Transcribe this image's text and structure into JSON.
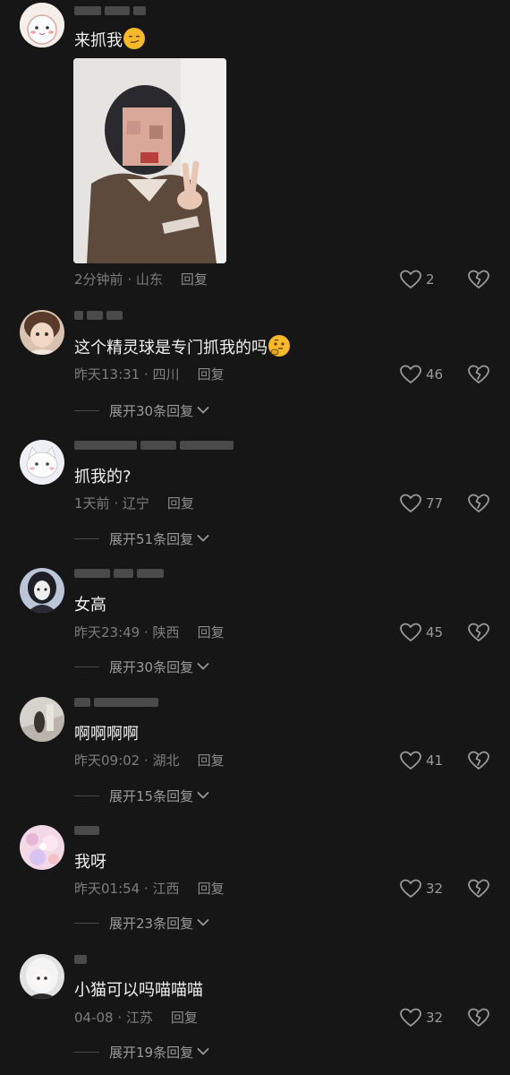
{
  "comments": [
    {
      "text": "来抓我",
      "emoji": "smirk-emoji",
      "time": "2分钟前",
      "location": "山东",
      "reply_label": "回复",
      "likes": "2"
    },
    {
      "text": "这个精灵球是专门抓我的吗",
      "emoji": "thinking-emoji",
      "time": "昨天13:31",
      "location": "四川",
      "reply_label": "回复",
      "likes": "46",
      "expand_label": "展开30条回复"
    },
    {
      "text": "抓我的?",
      "time": "1天前",
      "location": "辽宁",
      "reply_label": "回复",
      "likes": "77",
      "expand_label": "展开51条回复"
    },
    {
      "text": "女高",
      "time": "昨天23:49",
      "location": "陕西",
      "reply_label": "回复",
      "likes": "45",
      "expand_label": "展开30条回复"
    },
    {
      "text": "啊啊啊啊",
      "time": "昨天09:02",
      "location": "湖北",
      "reply_label": "回复",
      "likes": "41",
      "expand_label": "展开15条回复"
    },
    {
      "text": "我呀",
      "time": "昨天01:54",
      "location": "江西",
      "reply_label": "回复",
      "likes": "32",
      "expand_label": "展开23条回复"
    },
    {
      "text": "小猫可以吗喵喵喵",
      "time": "04-08",
      "location": "江苏",
      "reply_label": "回复",
      "likes": "32",
      "expand_label": "展开19条回复"
    }
  ],
  "colors": {
    "background": "#161616",
    "text": "#f0f0f0",
    "meta": "#7d7d7d"
  },
  "icons": {
    "like": "heart-outline-icon",
    "dislike": "broken-heart-icon",
    "expand": "chevron-down-icon"
  }
}
